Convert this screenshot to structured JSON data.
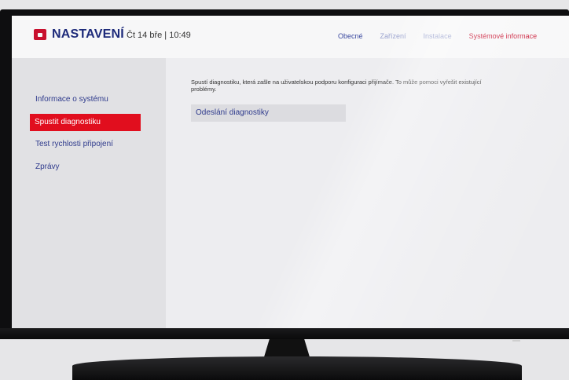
{
  "header": {
    "title": "NASTAVENÍ",
    "datetime": "Čt 14 bře | 10:49",
    "logo_icon": "brand-logo-icon",
    "tabs": [
      {
        "label": "Obecné",
        "state": "normal"
      },
      {
        "label": "Zařízení",
        "state": "dim"
      },
      {
        "label": "Instalace",
        "state": "dim"
      },
      {
        "label": "Systémové informace",
        "state": "active"
      }
    ]
  },
  "sidebar": {
    "items": [
      {
        "label": "Informace o systému"
      },
      {
        "label": "Spustit diagnostiku",
        "selected": true
      },
      {
        "label": "Test rychlosti připojení"
      },
      {
        "label": "Zprávy"
      }
    ]
  },
  "main": {
    "description": "Spustí diagnostiku, která zašle na uživatelskou podporu konfiguraci přijímače. To může pomoci vyřešit existující problémy.",
    "action_label": "Odeslání diagnostiky"
  },
  "colors": {
    "accent": "#e10e1e",
    "brand_blue": "#1d2a7a"
  }
}
